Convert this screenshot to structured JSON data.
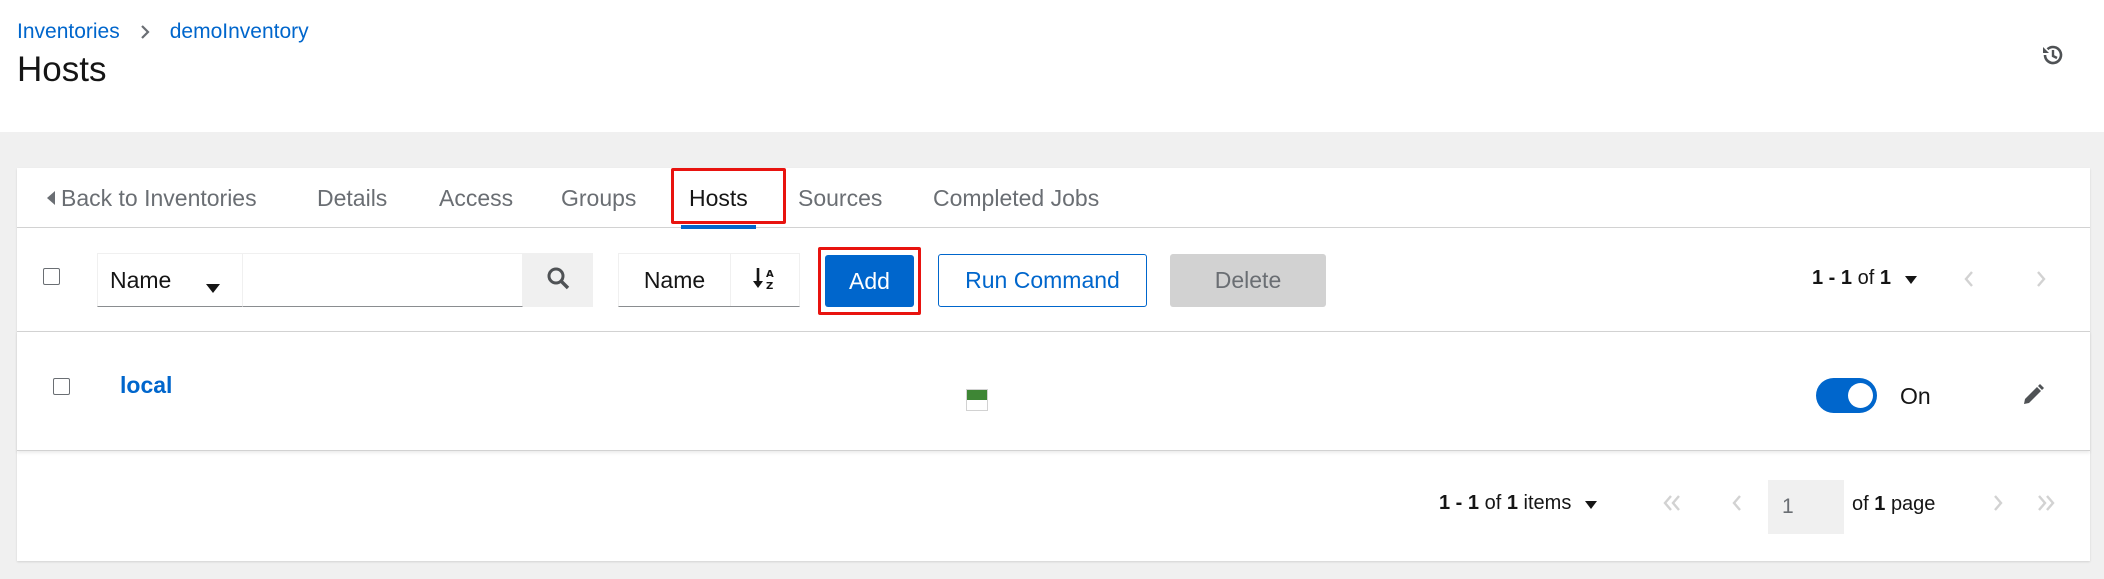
{
  "breadcrumb": {
    "inventories": "Inventories",
    "inventory": "demoInventory"
  },
  "page_title": "Hosts",
  "tabs": {
    "back": "Back to Inventories",
    "details": "Details",
    "access": "Access",
    "groups": "Groups",
    "hosts": "Hosts",
    "sources": "Sources",
    "completed_jobs": "Completed Jobs"
  },
  "toolbar": {
    "filter_field": "Name",
    "search_value": "",
    "sort_field": "Name",
    "add_label": "Add",
    "run_command_label": "Run Command",
    "delete_label": "Delete",
    "pagination_range": "1 - 1",
    "pagination_of": "of",
    "pagination_total": "1"
  },
  "hosts": [
    {
      "name": "local",
      "enabled_label": "On",
      "status_color": "#3e8635"
    }
  ],
  "pagination": {
    "range": "1 - 1",
    "of": "of",
    "total": "1",
    "items_label": "items",
    "page_value": "1",
    "of_page_prefix": "of",
    "page_total": "1",
    "page_label": "page"
  },
  "colors": {
    "accent": "#0066cc",
    "highlight": "#e8130f",
    "success": "#3e8635"
  },
  "icons": [
    "chevron-right-icon",
    "history-icon",
    "caret-left-icon",
    "caret-down-icon",
    "search-icon",
    "sort-alpha-icon",
    "angle-left-icon",
    "angle-right-icon",
    "pencil-icon",
    "angle-double-left-icon",
    "angle-double-right-icon"
  ]
}
